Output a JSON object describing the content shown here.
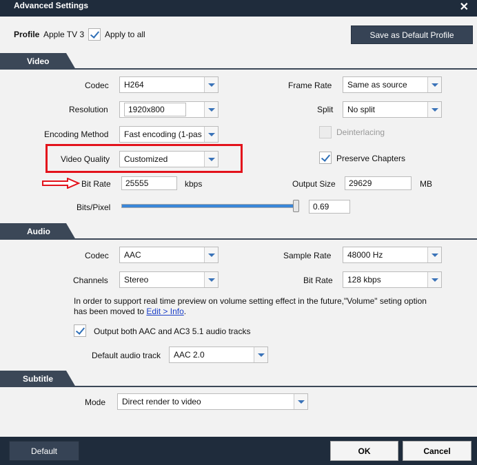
{
  "window": {
    "title": "Advanced Settings",
    "close_glyph": "✕"
  },
  "profile": {
    "label": "Profile",
    "value": "Apple TV 3",
    "apply_all_label": "Apply to all",
    "apply_all_checked": true,
    "save_default_label": "Save as Default Profile"
  },
  "video": {
    "section_label": "Video",
    "codec": {
      "label": "Codec",
      "value": "H264"
    },
    "resolution": {
      "label": "Resolution",
      "value": "1920x800"
    },
    "encoding_method": {
      "label": "Encoding Method",
      "value": "Fast encoding (1-pas"
    },
    "video_quality": {
      "label": "Video Quality",
      "value": "Customized"
    },
    "bit_rate": {
      "label": "Bit Rate",
      "value": "25555",
      "unit": "kbps"
    },
    "bits_per_pixel": {
      "label": "Bits/Pixel",
      "value": "0.69",
      "slider_fraction": 0.99
    },
    "frame_rate": {
      "label": "Frame Rate",
      "value": "Same as source"
    },
    "split": {
      "label": "Split",
      "value": "No split"
    },
    "deinterlacing": {
      "label": "Deinterlacing",
      "checked": false,
      "disabled": true
    },
    "preserve_chapters": {
      "label": "Preserve Chapters",
      "checked": true
    },
    "output_size": {
      "label": "Output Size",
      "value": "29629",
      "unit": "MB"
    }
  },
  "audio": {
    "section_label": "Audio",
    "codec": {
      "label": "Codec",
      "value": "AAC"
    },
    "channels": {
      "label": "Channels",
      "value": "Stereo"
    },
    "sample_rate": {
      "label": "Sample Rate",
      "value": "48000 Hz"
    },
    "bit_rate": {
      "label": "Bit Rate",
      "value": "128 kbps"
    },
    "notice_line1": "In order to support real time preview on volume setting effect in the future,\"Volume\" seting option",
    "notice_line2_prefix": "has been moved to ",
    "notice_link": "Edit > Info",
    "notice_line2_suffix": ".",
    "output_both": {
      "label": "Output both AAC and AC3 5.1 audio tracks",
      "checked": true
    },
    "default_track": {
      "label": "Default audio track",
      "value": "AAC 2.0"
    }
  },
  "subtitle": {
    "section_label": "Subtitle",
    "mode": {
      "label": "Mode",
      "value": "Direct render to video"
    }
  },
  "footer": {
    "default_label": "Default",
    "ok_label": "OK",
    "cancel_label": "Cancel"
  },
  "colors": {
    "accent": "#3a86d8",
    "annotation": "#e3121b",
    "header": "#1f2c3c"
  }
}
